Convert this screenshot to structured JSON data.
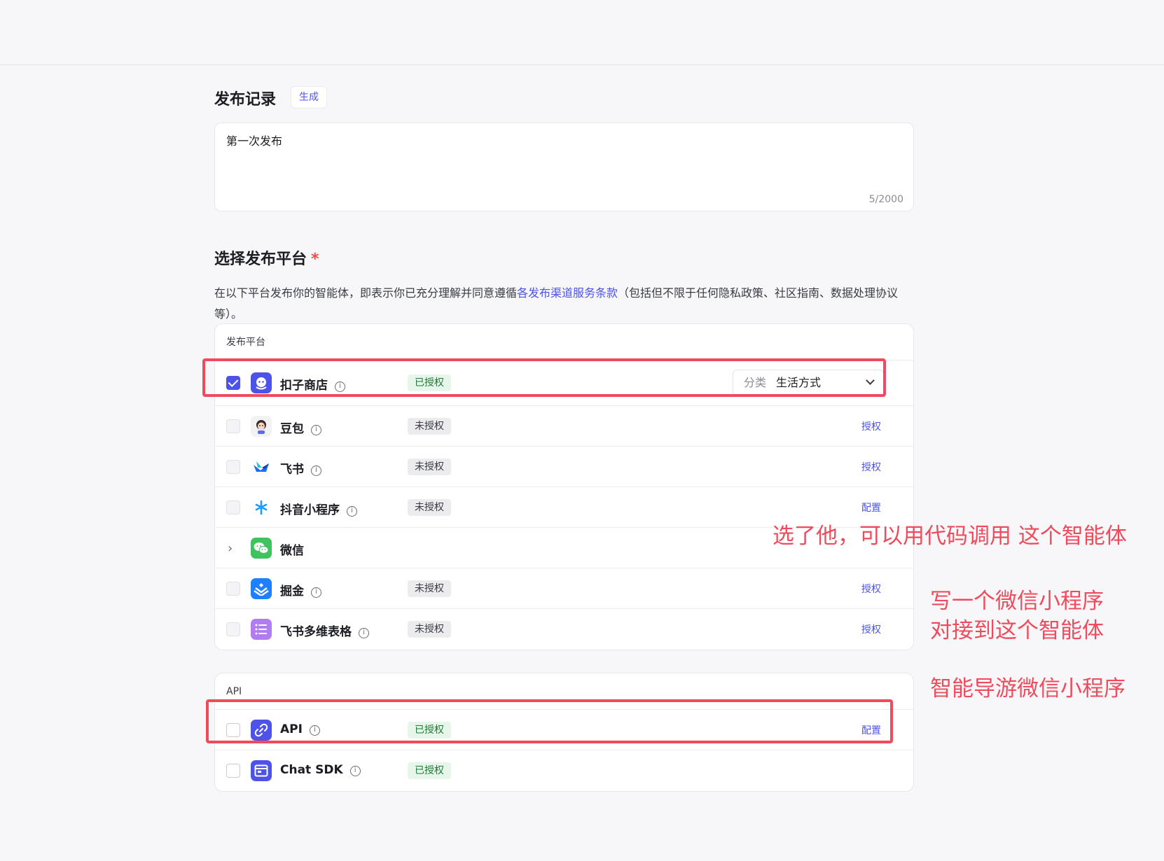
{
  "notes": {
    "title": "发布记录",
    "generate_label": "生成",
    "text": "第一次发布",
    "count": "5/2000"
  },
  "platforms_section": {
    "title": "选择发布平台",
    "required_mark": "*",
    "desc_before": "在以下平台发布你的智能体，即表示你已充分理解并同意遵循",
    "desc_link": "各发布渠道服务条款",
    "desc_after": "（包括但不限于任何隐私政策、社区指南、数据处理协议等）。"
  },
  "platform_card": {
    "header": "发布平台",
    "rows": [
      {
        "name": "扣子商店",
        "status": "已授权",
        "checked": true,
        "category_label": "分类",
        "category_value": "生活方式",
        "icon": "coze-store-icon",
        "color": "#4d53e8"
      },
      {
        "name": "豆包",
        "status": "未授权",
        "action": "授权",
        "icon": "doubao-icon",
        "color": "#f2f2f5"
      },
      {
        "name": "飞书",
        "status": "未授权",
        "action": "授权",
        "icon": "feishu-icon",
        "color": "#ffffff"
      },
      {
        "name": "抖音小程序",
        "status": "未授权",
        "action": "配置",
        "icon": "douyin-miniapp-icon",
        "color": "#ffffff"
      },
      {
        "name": "微信",
        "icon": "wechat-icon",
        "color": "#3fc35f"
      },
      {
        "name": "掘金",
        "status": "未授权",
        "action": "授权",
        "icon": "juejin-icon",
        "color": "#1e80ff"
      },
      {
        "name": "飞书多维表格",
        "status": "未授权",
        "action": "授权",
        "icon": "feishu-bitable-icon",
        "color": "#b07cf0"
      }
    ]
  },
  "api_card": {
    "header": "API",
    "rows": [
      {
        "name": "API",
        "status": "已授权",
        "action": "配置",
        "icon": "api-link-icon",
        "color": "#4d53e8"
      },
      {
        "name": "Chat SDK",
        "status": "已授权",
        "icon": "chat-sdk-icon",
        "color": "#4d53e8"
      }
    ]
  },
  "annotations": {
    "line1": "选了他，可以用代码调用 这个智能体",
    "line2a": "写一个微信小程序",
    "line2b": "对接到这个智能体",
    "line3": "智能导游微信小程序"
  },
  "colors": {
    "accent": "#4d53e8",
    "annotation": "#ef4b5c",
    "authorized_bg": "#e6f6ea",
    "unauthorized_bg": "#ececef"
  }
}
